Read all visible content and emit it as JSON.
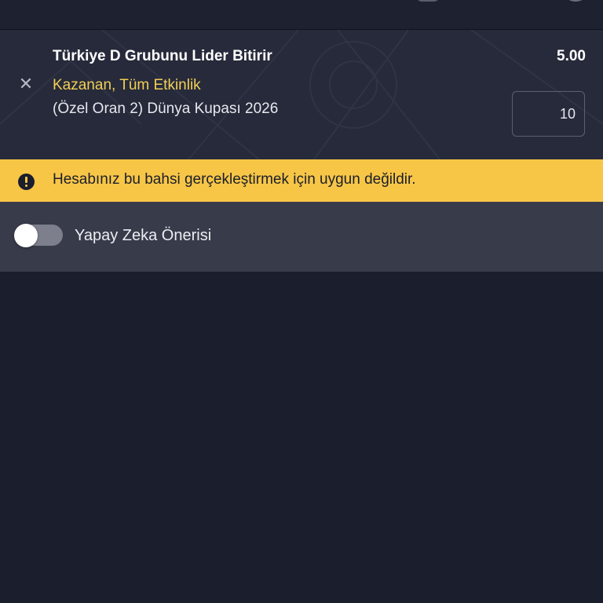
{
  "bet": {
    "remove_icon": "close-icon",
    "title": "Türkiye D Grubunu Lider Bitirir",
    "odds": "5.00",
    "market": "Kazanan, Tüm Etkinlik",
    "event": "(Özel Oran 2) Dünya Kupası 2026",
    "stake_value": "10"
  },
  "warning": {
    "icon": "exclamation-circle-icon",
    "text": "Hesabınız bu bahsi gerçekleştirmek için uygun değildir."
  },
  "ai_suggestion": {
    "label": "Yapay Zeka Önerisi",
    "enabled": false
  },
  "colors": {
    "background": "#1b1e2c",
    "card": "#262a3a",
    "accent_yellow": "#f2cf55",
    "warning_bg": "#f7c646",
    "toggle_row": "#383b4a"
  }
}
